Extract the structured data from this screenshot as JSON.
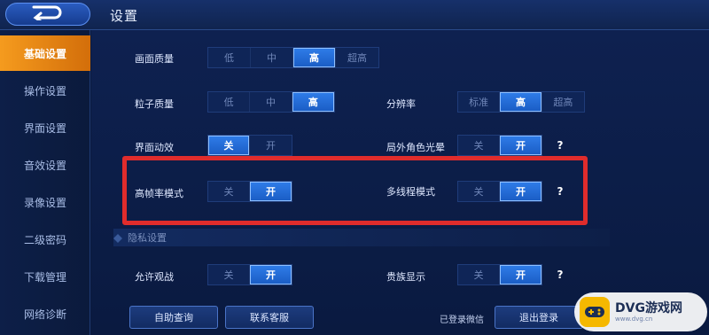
{
  "header": {
    "title": "设置"
  },
  "sidebar": {
    "items": [
      {
        "label": "基础设置",
        "active": true
      },
      {
        "label": "操作设置",
        "active": false
      },
      {
        "label": "界面设置",
        "active": false
      },
      {
        "label": "音效设置",
        "active": false
      },
      {
        "label": "录像设置",
        "active": false
      },
      {
        "label": "二级密码",
        "active": false
      },
      {
        "label": "下载管理",
        "active": false
      },
      {
        "label": "网络诊断",
        "active": false
      }
    ]
  },
  "settings": {
    "graphics_quality": {
      "label": "画面质量",
      "options": [
        "低",
        "中",
        "高",
        "超高"
      ],
      "selected": "高"
    },
    "particle_quality": {
      "label": "粒子质量",
      "options": [
        "低",
        "中",
        "高"
      ],
      "selected": "高"
    },
    "resolution": {
      "label": "分辨率",
      "options": [
        "标准",
        "高",
        "超高"
      ],
      "selected": "高"
    },
    "ui_animation": {
      "label": "界面动效",
      "options": [
        "关",
        "开"
      ],
      "selected": "关"
    },
    "outside_glow": {
      "label": "局外角色光晕",
      "options": [
        "关",
        "开"
      ],
      "selected": "开"
    },
    "high_fps": {
      "label": "高帧率模式",
      "options": [
        "关",
        "开"
      ],
      "selected": "开"
    },
    "multithread": {
      "label": "多线程模式",
      "options": [
        "关",
        "开"
      ],
      "selected": "开"
    },
    "privacy_section": "隐私设置",
    "allow_spectate": {
      "label": "允许观战",
      "options": [
        "关",
        "开"
      ],
      "selected": "开"
    },
    "clan_display": {
      "label": "贵族显示",
      "options": [
        "关",
        "开"
      ],
      "selected": "开"
    },
    "help_glyph": "?"
  },
  "footer": {
    "self_query": "自助查询",
    "contact_support": "联系客服",
    "login_status": "已登录微信",
    "logout": "退出登录"
  },
  "watermark": {
    "name": "DVG游戏网",
    "url": "www.dvg.cn"
  },
  "colors": {
    "accent_orange": "#f59b1e",
    "selected_blue": "#2f7de9",
    "highlight_red": "#e02c2c"
  }
}
